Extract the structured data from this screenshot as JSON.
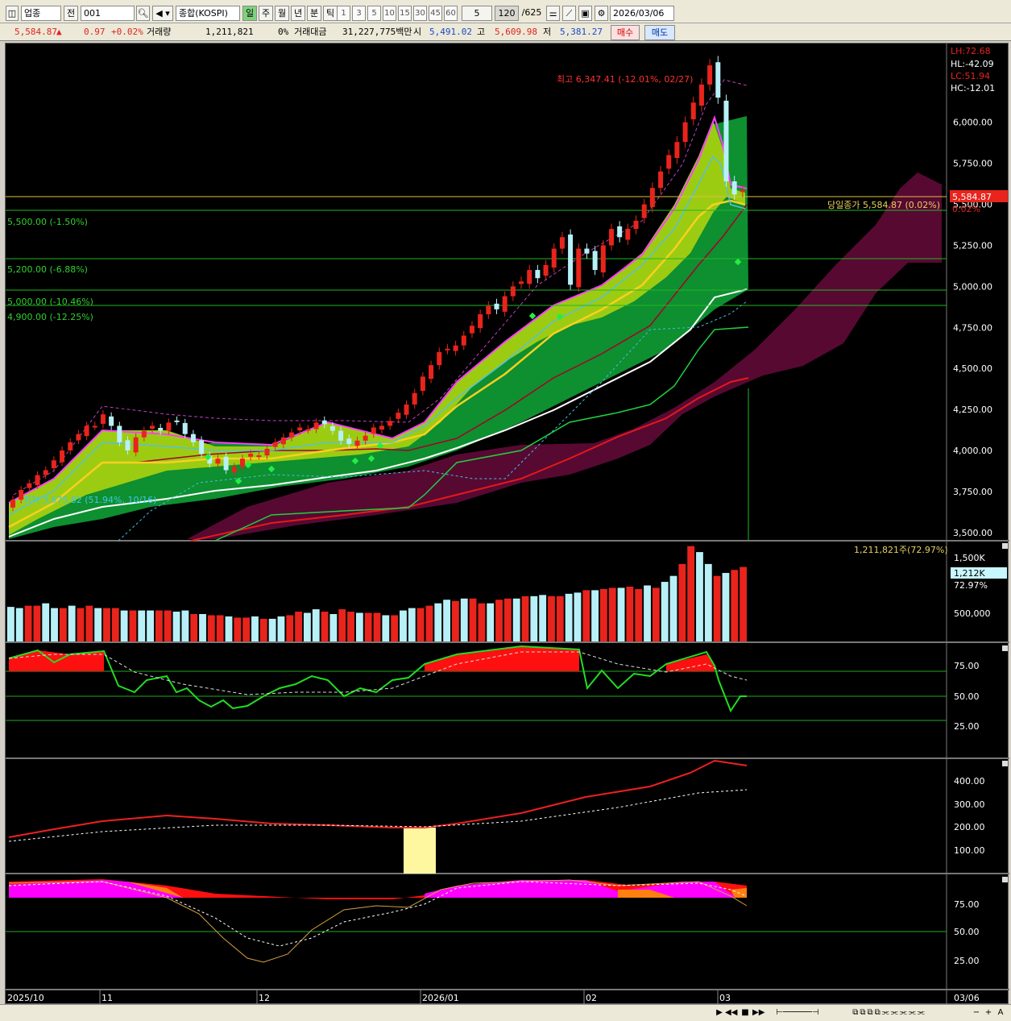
{
  "toolbar": {
    "market": "업종",
    "prefix": "전",
    "code": "001",
    "name": "종합(KOSPI)",
    "periods": [
      "일",
      "주",
      "월",
      "년",
      "분",
      "틱"
    ],
    "intervals": [
      "1",
      "3",
      "5",
      "10",
      "15",
      "30",
      "45",
      "60"
    ],
    "interval_sel": "5",
    "count": "120",
    "total": "/625",
    "date": "2026/03/06"
  },
  "infobar": {
    "price": "5,584.87",
    "arrow": "▲",
    "change": "0.97",
    "pct": "+0.02%",
    "vol_label": "거래량",
    "vol": "1,211,821",
    "vol_pct": "0%",
    "amt_label": "거래대금",
    "amt": "31,227,775백만",
    "open_label": "시",
    "open": "5,491.02",
    "high_label": "고",
    "high": "5,609.98",
    "low_label": "저",
    "low": "5,381.27",
    "buy": "매수",
    "sell": "매도"
  },
  "colors": {
    "up": "#e8241c",
    "down": "#b8f0f8",
    "bg": "#000000",
    "grid": "#1f9a1f"
  },
  "chart_data": [
    {
      "type": "candlestick",
      "x_labels": [
        "2025/10",
        "11",
        "12",
        "2026/01",
        "02",
        "03",
        "03/06"
      ],
      "y_ticks": [
        "6,000.00",
        "5,750.00",
        "5,500.00",
        "5,250.00",
        "5,000.00",
        "4,750.00",
        "4,500.00",
        "4,250.00",
        "4,000.00",
        "3,750.00",
        "3,500.00"
      ],
      "ylim": [
        3450,
        6480
      ],
      "annotations": {
        "max": "최고 6,347.41 (-12.01%, 02/27)",
        "min": "최저 3,675.82 (51.94%, 10/16)",
        "close": "당일종가 5,584.87 (0.02%)",
        "close_tag": "5,584.87",
        "close_pct": "0.02%",
        "stats": [
          "LH:72.68",
          "HL:-42.09",
          "LC:51.94",
          "HC:-12.01"
        ],
        "levels": [
          {
            "label": "5,500.00 (-1.50%)",
            "value": 5500
          },
          {
            "label": "5,200.00 (-6.88%)",
            "value": 5200
          },
          {
            "label": "5,000.00 (-10.46%)",
            "value": 5000
          },
          {
            "label": "4,900.00 (-12.25%)",
            "value": 4900
          }
        ]
      },
      "closes": [
        3700,
        3760,
        3800,
        3850,
        3880,
        3940,
        4000,
        4050,
        4100,
        4150,
        4150,
        4220,
        4150,
        4050,
        4000,
        4080,
        4120,
        4150,
        4120,
        4170,
        4180,
        4100,
        4050,
        3980,
        3920,
        3950,
        3880,
        3900,
        3950,
        3980,
        3970,
        4010,
        4050,
        4080,
        4110,
        4140,
        4130,
        4170,
        4160,
        4120,
        4060,
        4040,
        4060,
        4090,
        4140,
        4150,
        4180,
        4230,
        4280,
        4350,
        4450,
        4520,
        4600,
        4620,
        4640,
        4700,
        4760,
        4830,
        4880,
        4860,
        4940,
        5000,
        5030,
        5100,
        5050,
        5130,
        5230,
        5300,
        5010,
        5230,
        5200,
        5100,
        5250,
        5350,
        5300,
        5350,
        5400,
        5500,
        5600,
        5700,
        5800,
        5880,
        6000,
        6120,
        6230,
        6347,
        6150,
        5640,
        5560,
        5585
      ]
    },
    {
      "type": "bar",
      "title": "1,211,821주(72.97%)",
      "y_ticks": [
        "1,500K",
        "500,000"
      ],
      "tag": "1,212K",
      "tag_pct": "72.97%",
      "ylim": [
        0,
        1650000
      ],
      "values": [
        580,
        560,
        600,
        600,
        640,
        560,
        560,
        600,
        560,
        600,
        560,
        560,
        560,
        520,
        520,
        520,
        520,
        520,
        520,
        500,
        520,
        460,
        460,
        440,
        440,
        420,
        400,
        400,
        420,
        380,
        380,
        420,
        440,
        500,
        480,
        540,
        500,
        460,
        540,
        500,
        480,
        480,
        480,
        440,
        440,
        520,
        560,
        560,
        600,
        640,
        700,
        680,
        720,
        720,
        640,
        640,
        700,
        720,
        720,
        760,
        760,
        780,
        760,
        760,
        800,
        820,
        860,
        860,
        880,
        900,
        900,
        920,
        880,
        940,
        900,
        1000,
        1100,
        1300,
        1600,
        1500,
        1300,
        1100,
        1150,
        1200,
        1250
      ]
    },
    {
      "type": "line",
      "y_ticks": [
        "75.00",
        "50.00",
        "25.00"
      ],
      "ylim": [
        0,
        100
      ]
    },
    {
      "type": "line",
      "y_ticks": [
        "400.00",
        "300.00",
        "200.00",
        "100.00"
      ],
      "ylim": [
        0,
        500
      ]
    },
    {
      "type": "line",
      "y_ticks": [
        "75.00",
        "50.00",
        "25.00"
      ],
      "ylim": [
        0,
        100
      ]
    }
  ]
}
